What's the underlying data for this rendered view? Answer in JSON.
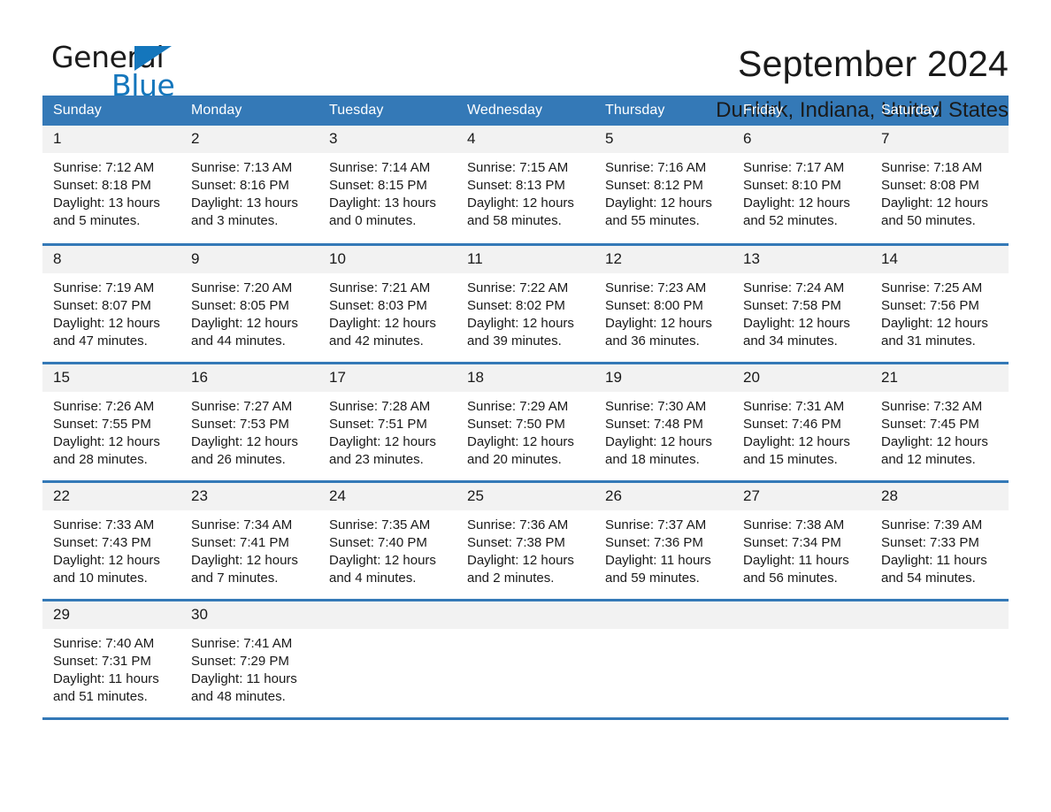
{
  "brand": {
    "word1": "General",
    "word2": "Blue",
    "triangle_color": "#1476bc"
  },
  "header": {
    "title": "September 2024",
    "subtitle": "Dunkirk, Indiana, United States",
    "accent_color": "#3479b7",
    "daynum_band_color": "#f2f2f2"
  },
  "weekday_headers": [
    "Sunday",
    "Monday",
    "Tuesday",
    "Wednesday",
    "Thursday",
    "Friday",
    "Saturday"
  ],
  "labels": {
    "sunrise": "Sunrise:",
    "sunset": "Sunset:",
    "daylight": "Daylight:"
  },
  "weeks": [
    [
      {
        "day": "1",
        "sunrise": "Sunrise: 7:12 AM",
        "sunset": "Sunset: 8:18 PM",
        "daylight_1": "Daylight: 13 hours",
        "daylight_2": "and 5 minutes."
      },
      {
        "day": "2",
        "sunrise": "Sunrise: 7:13 AM",
        "sunset": "Sunset: 8:16 PM",
        "daylight_1": "Daylight: 13 hours",
        "daylight_2": "and 3 minutes."
      },
      {
        "day": "3",
        "sunrise": "Sunrise: 7:14 AM",
        "sunset": "Sunset: 8:15 PM",
        "daylight_1": "Daylight: 13 hours",
        "daylight_2": "and 0 minutes."
      },
      {
        "day": "4",
        "sunrise": "Sunrise: 7:15 AM",
        "sunset": "Sunset: 8:13 PM",
        "daylight_1": "Daylight: 12 hours",
        "daylight_2": "and 58 minutes."
      },
      {
        "day": "5",
        "sunrise": "Sunrise: 7:16 AM",
        "sunset": "Sunset: 8:12 PM",
        "daylight_1": "Daylight: 12 hours",
        "daylight_2": "and 55 minutes."
      },
      {
        "day": "6",
        "sunrise": "Sunrise: 7:17 AM",
        "sunset": "Sunset: 8:10 PM",
        "daylight_1": "Daylight: 12 hours",
        "daylight_2": "and 52 minutes."
      },
      {
        "day": "7",
        "sunrise": "Sunrise: 7:18 AM",
        "sunset": "Sunset: 8:08 PM",
        "daylight_1": "Daylight: 12 hours",
        "daylight_2": "and 50 minutes."
      }
    ],
    [
      {
        "day": "8",
        "sunrise": "Sunrise: 7:19 AM",
        "sunset": "Sunset: 8:07 PM",
        "daylight_1": "Daylight: 12 hours",
        "daylight_2": "and 47 minutes."
      },
      {
        "day": "9",
        "sunrise": "Sunrise: 7:20 AM",
        "sunset": "Sunset: 8:05 PM",
        "daylight_1": "Daylight: 12 hours",
        "daylight_2": "and 44 minutes."
      },
      {
        "day": "10",
        "sunrise": "Sunrise: 7:21 AM",
        "sunset": "Sunset: 8:03 PM",
        "daylight_1": "Daylight: 12 hours",
        "daylight_2": "and 42 minutes."
      },
      {
        "day": "11",
        "sunrise": "Sunrise: 7:22 AM",
        "sunset": "Sunset: 8:02 PM",
        "daylight_1": "Daylight: 12 hours",
        "daylight_2": "and 39 minutes."
      },
      {
        "day": "12",
        "sunrise": "Sunrise: 7:23 AM",
        "sunset": "Sunset: 8:00 PM",
        "daylight_1": "Daylight: 12 hours",
        "daylight_2": "and 36 minutes."
      },
      {
        "day": "13",
        "sunrise": "Sunrise: 7:24 AM",
        "sunset": "Sunset: 7:58 PM",
        "daylight_1": "Daylight: 12 hours",
        "daylight_2": "and 34 minutes."
      },
      {
        "day": "14",
        "sunrise": "Sunrise: 7:25 AM",
        "sunset": "Sunset: 7:56 PM",
        "daylight_1": "Daylight: 12 hours",
        "daylight_2": "and 31 minutes."
      }
    ],
    [
      {
        "day": "15",
        "sunrise": "Sunrise: 7:26 AM",
        "sunset": "Sunset: 7:55 PM",
        "daylight_1": "Daylight: 12 hours",
        "daylight_2": "and 28 minutes."
      },
      {
        "day": "16",
        "sunrise": "Sunrise: 7:27 AM",
        "sunset": "Sunset: 7:53 PM",
        "daylight_1": "Daylight: 12 hours",
        "daylight_2": "and 26 minutes."
      },
      {
        "day": "17",
        "sunrise": "Sunrise: 7:28 AM",
        "sunset": "Sunset: 7:51 PM",
        "daylight_1": "Daylight: 12 hours",
        "daylight_2": "and 23 minutes."
      },
      {
        "day": "18",
        "sunrise": "Sunrise: 7:29 AM",
        "sunset": "Sunset: 7:50 PM",
        "daylight_1": "Daylight: 12 hours",
        "daylight_2": "and 20 minutes."
      },
      {
        "day": "19",
        "sunrise": "Sunrise: 7:30 AM",
        "sunset": "Sunset: 7:48 PM",
        "daylight_1": "Daylight: 12 hours",
        "daylight_2": "and 18 minutes."
      },
      {
        "day": "20",
        "sunrise": "Sunrise: 7:31 AM",
        "sunset": "Sunset: 7:46 PM",
        "daylight_1": "Daylight: 12 hours",
        "daylight_2": "and 15 minutes."
      },
      {
        "day": "21",
        "sunrise": "Sunrise: 7:32 AM",
        "sunset": "Sunset: 7:45 PM",
        "daylight_1": "Daylight: 12 hours",
        "daylight_2": "and 12 minutes."
      }
    ],
    [
      {
        "day": "22",
        "sunrise": "Sunrise: 7:33 AM",
        "sunset": "Sunset: 7:43 PM",
        "daylight_1": "Daylight: 12 hours",
        "daylight_2": "and 10 minutes."
      },
      {
        "day": "23",
        "sunrise": "Sunrise: 7:34 AM",
        "sunset": "Sunset: 7:41 PM",
        "daylight_1": "Daylight: 12 hours",
        "daylight_2": "and 7 minutes."
      },
      {
        "day": "24",
        "sunrise": "Sunrise: 7:35 AM",
        "sunset": "Sunset: 7:40 PM",
        "daylight_1": "Daylight: 12 hours",
        "daylight_2": "and 4 minutes."
      },
      {
        "day": "25",
        "sunrise": "Sunrise: 7:36 AM",
        "sunset": "Sunset: 7:38 PM",
        "daylight_1": "Daylight: 12 hours",
        "daylight_2": "and 2 minutes."
      },
      {
        "day": "26",
        "sunrise": "Sunrise: 7:37 AM",
        "sunset": "Sunset: 7:36 PM",
        "daylight_1": "Daylight: 11 hours",
        "daylight_2": "and 59 minutes."
      },
      {
        "day": "27",
        "sunrise": "Sunrise: 7:38 AM",
        "sunset": "Sunset: 7:34 PM",
        "daylight_1": "Daylight: 11 hours",
        "daylight_2": "and 56 minutes."
      },
      {
        "day": "28",
        "sunrise": "Sunrise: 7:39 AM",
        "sunset": "Sunset: 7:33 PM",
        "daylight_1": "Daylight: 11 hours",
        "daylight_2": "and 54 minutes."
      }
    ],
    [
      {
        "day": "29",
        "sunrise": "Sunrise: 7:40 AM",
        "sunset": "Sunset: 7:31 PM",
        "daylight_1": "Daylight: 11 hours",
        "daylight_2": "and 51 minutes."
      },
      {
        "day": "30",
        "sunrise": "Sunrise: 7:41 AM",
        "sunset": "Sunset: 7:29 PM",
        "daylight_1": "Daylight: 11 hours",
        "daylight_2": "and 48 minutes."
      },
      {
        "day": "",
        "sunrise": "",
        "sunset": "",
        "daylight_1": "",
        "daylight_2": ""
      },
      {
        "day": "",
        "sunrise": "",
        "sunset": "",
        "daylight_1": "",
        "daylight_2": ""
      },
      {
        "day": "",
        "sunrise": "",
        "sunset": "",
        "daylight_1": "",
        "daylight_2": ""
      },
      {
        "day": "",
        "sunrise": "",
        "sunset": "",
        "daylight_1": "",
        "daylight_2": ""
      },
      {
        "day": "",
        "sunrise": "",
        "sunset": "",
        "daylight_1": "",
        "daylight_2": ""
      }
    ]
  ]
}
